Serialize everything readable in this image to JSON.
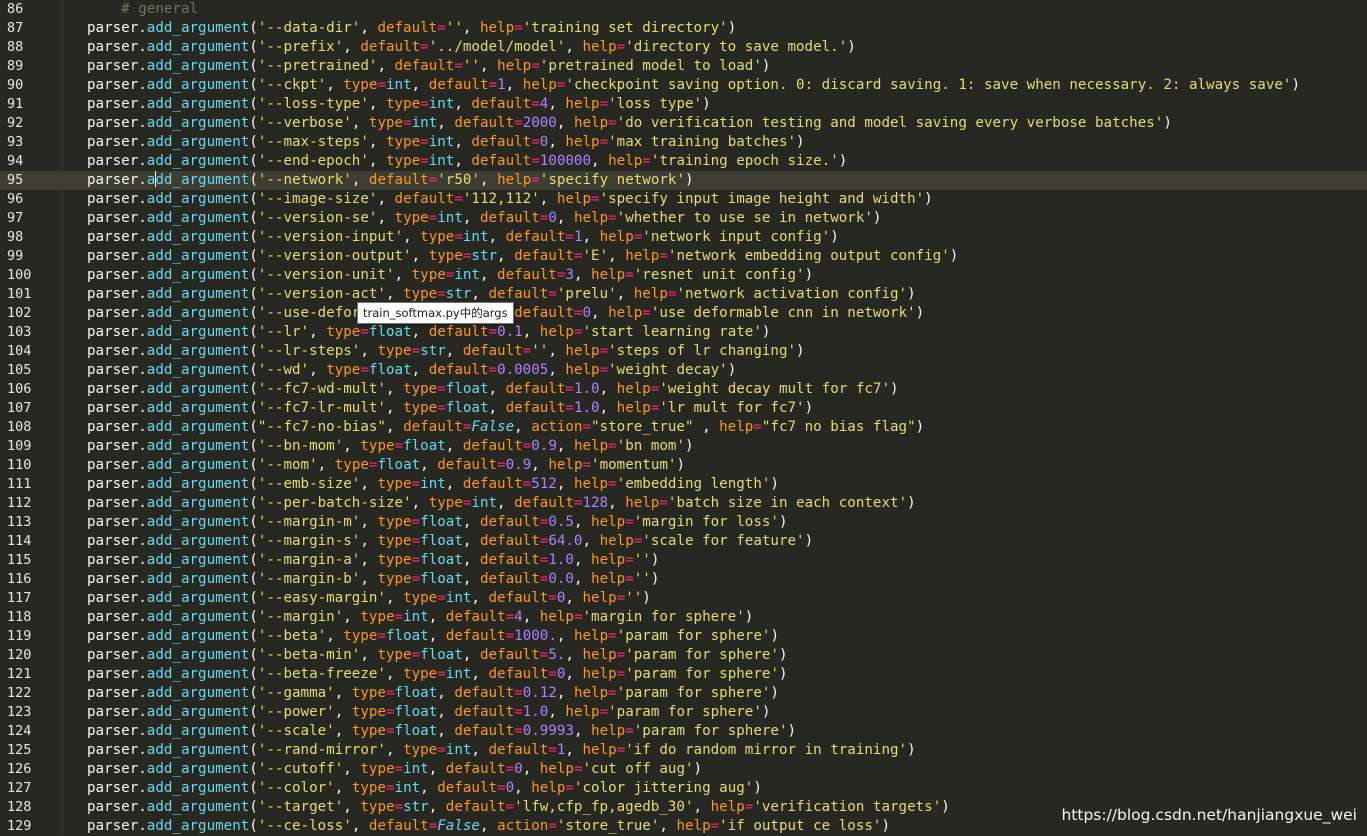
{
  "editor": {
    "current_line": 95,
    "caret_after": "parser.a",
    "lines": [
      {
        "n": "86",
        "code": "    # general"
      },
      {
        "n": "87",
        "code": "parser.add_argument('--data-dir', default='', help='training set directory')"
      },
      {
        "n": "88",
        "code": "parser.add_argument('--prefix', default='../model/model', help='directory to save model.')"
      },
      {
        "n": "89",
        "code": "parser.add_argument('--pretrained', default='', help='pretrained model to load')"
      },
      {
        "n": "90",
        "code": "parser.add_argument('--ckpt', type=int, default=1, help='checkpoint saving option. 0: discard saving. 1: save when necessary. 2: always save')"
      },
      {
        "n": "91",
        "code": "parser.add_argument('--loss-type', type=int, default=4, help='loss type')"
      },
      {
        "n": "92",
        "code": "parser.add_argument('--verbose', type=int, default=2000, help='do verification testing and model saving every verbose batches')"
      },
      {
        "n": "93",
        "code": "parser.add_argument('--max-steps', type=int, default=0, help='max training batches')"
      },
      {
        "n": "94",
        "code": "parser.add_argument('--end-epoch', type=int, default=100000, help='training epoch size.')"
      },
      {
        "n": "95",
        "code": "parser.add_argument('--network', default='r50', help='specify network')"
      },
      {
        "n": "96",
        "code": "parser.add_argument('--image-size', default='112,112', help='specify input image height and width')"
      },
      {
        "n": "97",
        "code": "parser.add_argument('--version-se', type=int, default=0, help='whether to use se in network')"
      },
      {
        "n": "98",
        "code": "parser.add_argument('--version-input', type=int, default=1, help='network input config')"
      },
      {
        "n": "99",
        "code": "parser.add_argument('--version-output', type=str, default='E', help='network embedding output config')"
      },
      {
        "n": "100",
        "code": "parser.add_argument('--version-unit', type=int, default=3, help='resnet unit config')"
      },
      {
        "n": "101",
        "code": "parser.add_argument('--version-act', type=str, default='prelu', help='network activation config')"
      },
      {
        "n": "102",
        "code": "parser.add_argument('--use-deformable', type=int, default=0, help='use deformable cnn in network')"
      },
      {
        "n": "103",
        "code": "parser.add_argument('--lr', type=float, default=0.1, help='start learning rate')"
      },
      {
        "n": "104",
        "code": "parser.add_argument('--lr-steps', type=str, default='', help='steps of lr changing')"
      },
      {
        "n": "105",
        "code": "parser.add_argument('--wd', type=float, default=0.0005, help='weight decay')"
      },
      {
        "n": "106",
        "code": "parser.add_argument('--fc7-wd-mult', type=float, default=1.0, help='weight decay mult for fc7')"
      },
      {
        "n": "107",
        "code": "parser.add_argument('--fc7-lr-mult', type=float, default=1.0, help='lr mult for fc7')"
      },
      {
        "n": "108",
        "code": "parser.add_argument(\"--fc7-no-bias\", default=False, action=\"store_true\" , help=\"fc7 no bias flag\")"
      },
      {
        "n": "109",
        "code": "parser.add_argument('--bn-mom', type=float, default=0.9, help='bn mom')"
      },
      {
        "n": "110",
        "code": "parser.add_argument('--mom', type=float, default=0.9, help='momentum')"
      },
      {
        "n": "111",
        "code": "parser.add_argument('--emb-size', type=int, default=512, help='embedding length')"
      },
      {
        "n": "112",
        "code": "parser.add_argument('--per-batch-size', type=int, default=128, help='batch size in each context')"
      },
      {
        "n": "113",
        "code": "parser.add_argument('--margin-m', type=float, default=0.5, help='margin for loss')"
      },
      {
        "n": "114",
        "code": "parser.add_argument('--margin-s', type=float, default=64.0, help='scale for feature')"
      },
      {
        "n": "115",
        "code": "parser.add_argument('--margin-a', type=float, default=1.0, help='')"
      },
      {
        "n": "116",
        "code": "parser.add_argument('--margin-b', type=float, default=0.0, help='')"
      },
      {
        "n": "117",
        "code": "parser.add_argument('--easy-margin', type=int, default=0, help='')"
      },
      {
        "n": "118",
        "code": "parser.add_argument('--margin', type=int, default=4, help='margin for sphere')"
      },
      {
        "n": "119",
        "code": "parser.add_argument('--beta', type=float, default=1000., help='param for sphere')"
      },
      {
        "n": "120",
        "code": "parser.add_argument('--beta-min', type=float, default=5., help='param for sphere')"
      },
      {
        "n": "121",
        "code": "parser.add_argument('--beta-freeze', type=int, default=0, help='param for sphere')"
      },
      {
        "n": "122",
        "code": "parser.add_argument('--gamma', type=float, default=0.12, help='param for sphere')"
      },
      {
        "n": "123",
        "code": "parser.add_argument('--power', type=float, default=1.0, help='param for sphere')"
      },
      {
        "n": "124",
        "code": "parser.add_argument('--scale', type=float, default=0.9993, help='param for sphere')"
      },
      {
        "n": "125",
        "code": "parser.add_argument('--rand-mirror', type=int, default=1, help='if do random mirror in training')"
      },
      {
        "n": "126",
        "code": "parser.add_argument('--cutoff', type=int, default=0, help='cut off aug')"
      },
      {
        "n": "127",
        "code": "parser.add_argument('--color', type=int, default=0, help='color jittering aug')"
      },
      {
        "n": "128",
        "code": "parser.add_argument('--target', type=str, default='lfw,cfp_fp,agedb_30', help='verification targets')"
      },
      {
        "n": "129",
        "code": "parser.add_argument('--ce-loss', default=False, action='store_true', help='if output ce loss')"
      }
    ]
  },
  "tooltip": {
    "text": "train_softmax.py中的args"
  },
  "watermark": {
    "text": "https://blog.csdn.net/hanjiangxue_wei"
  },
  "colors": {
    "background": "#272822",
    "current_line": "#3e3d32",
    "comment": "#75715e",
    "function": "#66d9ef",
    "string": "#e6db74",
    "keyword_arg": "#fd971f",
    "operator": "#f92672",
    "number": "#ae81ff"
  }
}
